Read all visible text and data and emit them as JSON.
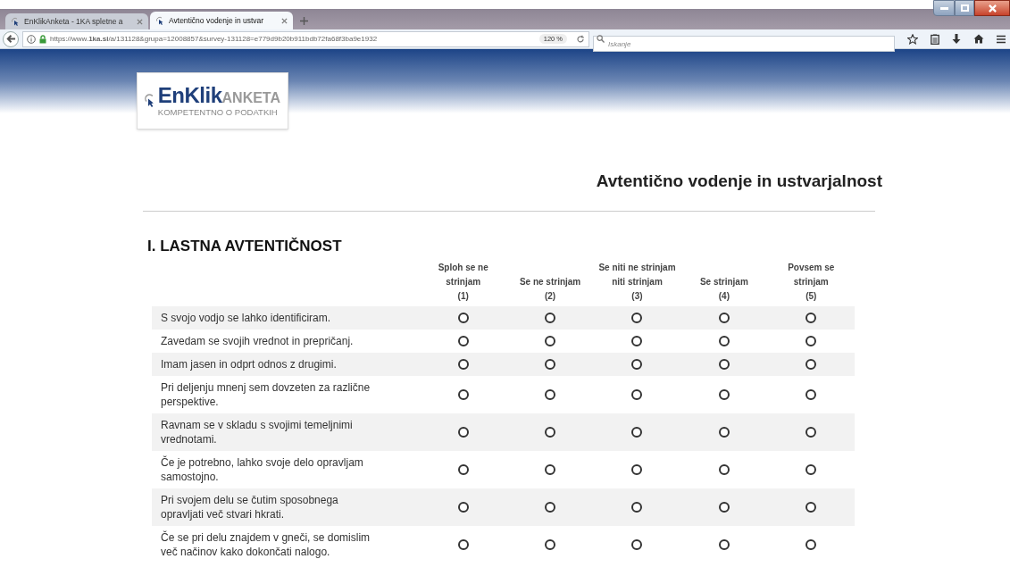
{
  "browser": {
    "tabs": [
      {
        "label": "EnKlikAnketa - 1KA spletne a",
        "selected": false
      },
      {
        "label": "Avtentično vodenje in ustvar",
        "selected": true
      }
    ],
    "url": "https://www.**1ka.si**/a/131128&grupa=12008857&survey-131128=e779d9b20b911bdb72fa68f3ba9e1932",
    "zoom": "120 %",
    "search": {
      "placeholder": "Iskanje"
    }
  },
  "logo": {
    "brand": "EnKlik",
    "product": "ANKETA",
    "tagline": "KOMPETENTNO O PODATKIH"
  },
  "survey_title": "Avtentično vodenje in ustvarjalnost",
  "section_title": "I. LASTNA AVTENTIČNOST",
  "columns": [
    {
      "label": "Sploh se ne strinjam",
      "code": "(1)"
    },
    {
      "label": "Se ne strinjam",
      "code": "(2)"
    },
    {
      "label": "Se niti ne strinjam niti strinjam",
      "code": "(3)"
    },
    {
      "label": "Se strinjam",
      "code": "(4)"
    },
    {
      "label": "Povsem se strinjam",
      "code": "(5)"
    }
  ],
  "rows": [
    {
      "statement": "S svojo vodjo se lahko identificiram.",
      "answers": [
        {
          "selected": false
        },
        {
          "selected": false
        },
        {
          "selected": false
        },
        {
          "selected": false
        },
        {
          "selected": false
        }
      ]
    },
    {
      "statement": "Zavedam se svojih vrednot in prepričanj.",
      "answers": [
        {
          "selected": false
        },
        {
          "selected": false
        },
        {
          "selected": false
        },
        {
          "selected": false
        },
        {
          "selected": false
        }
      ]
    },
    {
      "statement": "Imam jasen in odprt odnos z drugimi.",
      "answers": [
        {
          "selected": false
        },
        {
          "selected": false
        },
        {
          "selected": false
        },
        {
          "selected": false
        },
        {
          "selected": false
        }
      ]
    },
    {
      "statement": "Pri deljenju mnenj sem dovzeten za različne perspektive.",
      "answers": [
        {
          "selected": false
        },
        {
          "selected": false
        },
        {
          "selected": false
        },
        {
          "selected": false
        },
        {
          "selected": false
        }
      ]
    },
    {
      "statement": "Ravnam se v skladu s svojimi temeljnimi vrednotami.",
      "answers": [
        {
          "selected": false
        },
        {
          "selected": false
        },
        {
          "selected": false
        },
        {
          "selected": false
        },
        {
          "selected": false
        }
      ]
    },
    {
      "statement": "Če je potrebno, lahko svoje delo opravljam samostojno.",
      "answers": [
        {
          "selected": false
        },
        {
          "selected": false
        },
        {
          "selected": false
        },
        {
          "selected": false
        },
        {
          "selected": false
        }
      ]
    },
    {
      "statement": "Pri svojem delu se čutim sposobnega opravljati več stvari hkrati.",
      "answers": [
        {
          "selected": false
        },
        {
          "selected": false
        },
        {
          "selected": false
        },
        {
          "selected": false
        },
        {
          "selected": false
        }
      ]
    },
    {
      "statement": "Če se pri delu znajdem v gneči, se domislim več načinov kako dokončati nalogo.",
      "answers": [
        {
          "selected": false
        },
        {
          "selected": false
        },
        {
          "selected": false
        },
        {
          "selected": false
        },
        {
          "selected": false
        }
      ]
    }
  ]
}
